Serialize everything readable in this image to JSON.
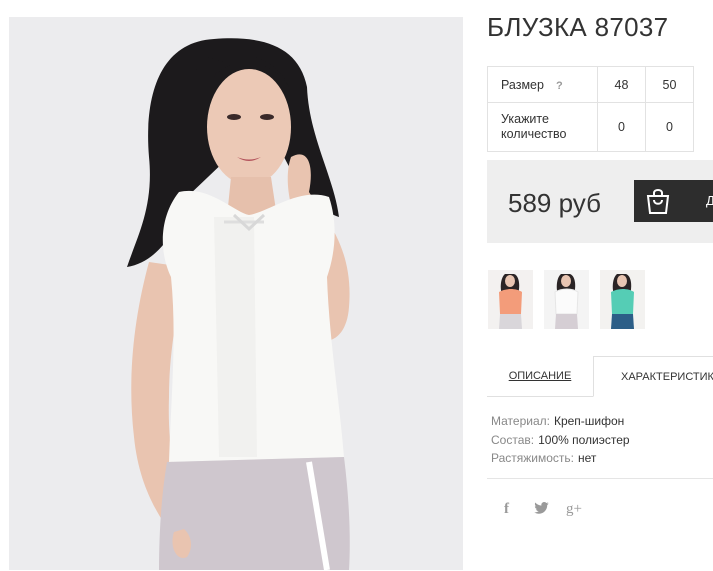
{
  "product": {
    "title": "БЛУЗКА 87037",
    "image_alt": "woman-in-white-blouse-photo"
  },
  "sizes_table": {
    "size_label": "Размер",
    "help_label": "?",
    "sizes": [
      "48",
      "50"
    ],
    "quantity_label": "Укажите количество",
    "quantities": [
      "0",
      "0"
    ]
  },
  "price": {
    "value": "589 руб",
    "cart_button_label": "Д",
    "cart_icon": "shopping-bag-icon"
  },
  "thumbnails": [
    {
      "name": "coral-top-thumbnail"
    },
    {
      "name": "white-blouse-thumbnail"
    },
    {
      "name": "mint-top-thumbnail"
    }
  ],
  "tabs": [
    {
      "label": "ОПИСАНИЕ",
      "active": false
    },
    {
      "label": "ХАРАКТЕРИСТИКИ",
      "active": true
    }
  ],
  "characteristics": [
    {
      "key": "Материал:",
      "value": "Креп-шифон"
    },
    {
      "key": "Состав:",
      "value": "100% полиэстер"
    },
    {
      "key": "Растяжимость:",
      "value": "нет"
    }
  ],
  "social": {
    "icons": [
      "facebook-icon",
      "twitter-icon",
      "google-plus-icon"
    ],
    "facebook": "f",
    "google_plus": "g+"
  },
  "colors": {
    "accent_dark": "#2d2d2d",
    "price_bg": "#eeeeee",
    "photo_bg": "#ececee"
  }
}
